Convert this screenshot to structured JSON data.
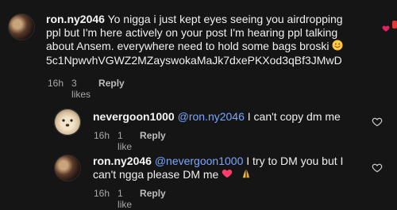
{
  "comments": [
    {
      "username": "ron.ny2046",
      "text_lines": [
        "Yo nigga i just kept eyes seeing you airdropping",
        "ppl but I'm here actively on your post I'm hearing ppl talking",
        "about Ansem. everywhere need to hold some bags broski",
        "5c1NpwvhVGWZ2MZayswokaMaJk7dxePKXod3qBf3JMwD"
      ],
      "emoji": "smile-emoji",
      "time": "16h",
      "likes": "3 likes",
      "reply": "Reply",
      "liked": true
    },
    {
      "username": "nevergoon1000",
      "mention": "@ron.ny2046",
      "text": "I can't copy dm me",
      "time": "16h",
      "likes": "1 like",
      "reply": "Reply",
      "liked": false
    },
    {
      "username": "ron.ny2046",
      "mention": "@nevergoon1000",
      "text_line1": "I try to DM you but I",
      "text_line2": "can't ngga please DM me",
      "time": "16h",
      "likes": "1 like",
      "reply": "Reply",
      "liked": false
    }
  ],
  "colors": {
    "background": "#151515",
    "mention": "#7aa6ff",
    "meta": "#a8a8a8",
    "heart": "#e0245e"
  }
}
